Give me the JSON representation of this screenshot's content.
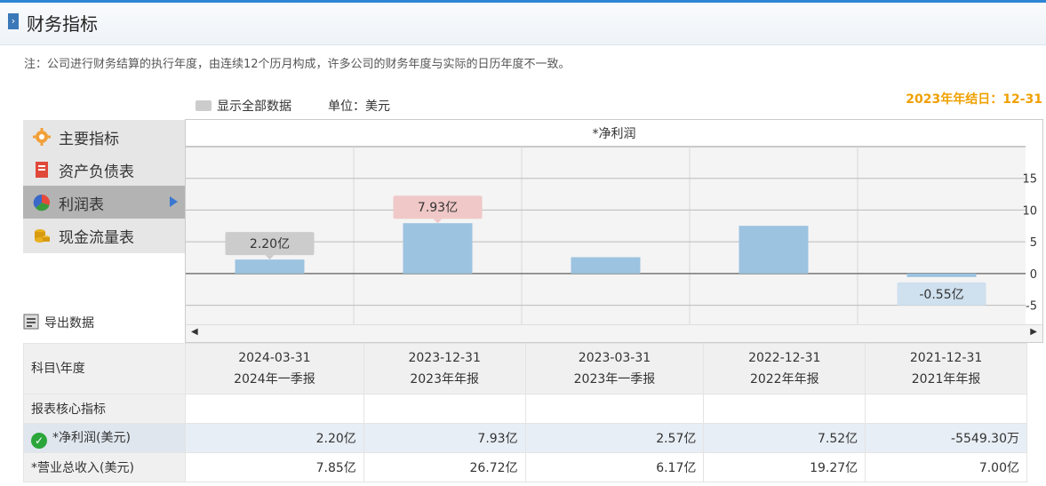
{
  "header": {
    "title": "财务指标",
    "marker_icon": "chevron-right-icon"
  },
  "note": "注：公司进行财务结算的执行年度，由连续12个历月构成，许多公司的财务年度与实际的日历年度不一致。",
  "year_end": "2023年年结日：12-31",
  "controls": {
    "show_all_label": "显示全部数据",
    "unit_label": "单位：美元"
  },
  "nav": {
    "items": [
      {
        "label": "主要指标",
        "icon": "gear-icon"
      },
      {
        "label": "资产负债表",
        "icon": "document-icon"
      },
      {
        "label": "利润表",
        "icon": "pie-icon",
        "active": true
      },
      {
        "label": "现金流量表",
        "icon": "coins-icon"
      }
    ]
  },
  "export_label": "导出数据",
  "chart_data": {
    "type": "bar",
    "title": "*净利润",
    "categories": [
      "2024-03-31",
      "2023-12-31",
      "2023-03-31",
      "2022-12-31",
      "2021-12-31"
    ],
    "values": [
      2.2,
      7.93,
      2.57,
      7.52,
      -0.55
    ],
    "data_labels": [
      "2.20亿",
      "7.93亿",
      "",
      "",
      "-0.55亿"
    ],
    "label_colors": [
      "#cccccc",
      "#f0c8c8",
      "",
      "",
      "#cfe0ee"
    ],
    "bar_color": "#9cc3e0",
    "ylim": [
      -8,
      20
    ],
    "yticks": [
      15,
      10,
      5,
      0,
      -5
    ],
    "grid": true
  },
  "table": {
    "header_label": "科目\\年度",
    "columns": [
      {
        "date": "2024-03-31",
        "period": "2024年一季报"
      },
      {
        "date": "2023-12-31",
        "period": "2023年年报"
      },
      {
        "date": "2023-03-31",
        "period": "2023年一季报"
      },
      {
        "date": "2022-12-31",
        "period": "2022年年报"
      },
      {
        "date": "2021-12-31",
        "period": "2021年年报"
      }
    ],
    "section_label": "报表核心指标",
    "rows": [
      {
        "label": "*净利润(美元)",
        "values": [
          "2.20亿",
          "7.93亿",
          "2.57亿",
          "7.52亿",
          "-5549.30万"
        ]
      },
      {
        "label": "*营业总收入(美元)",
        "values": [
          "7.85亿",
          "26.72亿",
          "6.17亿",
          "19.27亿",
          "7.00亿"
        ]
      }
    ]
  }
}
